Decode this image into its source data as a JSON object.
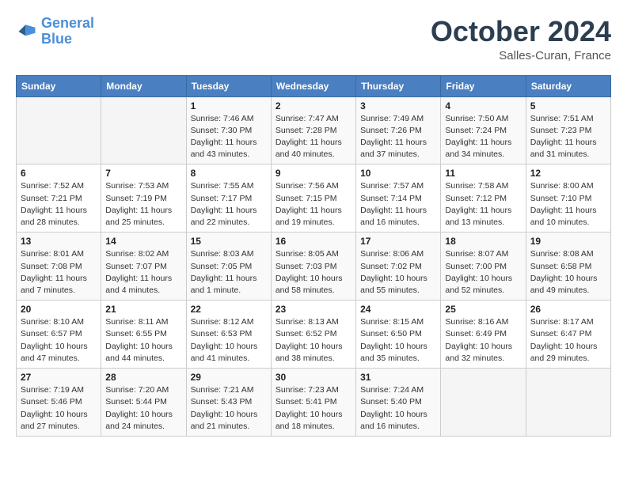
{
  "header": {
    "logo_line1": "General",
    "logo_line2": "Blue",
    "month_title": "October 2024",
    "location": "Salles-Curan, France"
  },
  "weekdays": [
    "Sunday",
    "Monday",
    "Tuesday",
    "Wednesday",
    "Thursday",
    "Friday",
    "Saturday"
  ],
  "weeks": [
    [
      null,
      null,
      {
        "day": 1,
        "sunrise": "7:46 AM",
        "sunset": "7:30 PM",
        "daylight": "11 hours and 43 minutes."
      },
      {
        "day": 2,
        "sunrise": "7:47 AM",
        "sunset": "7:28 PM",
        "daylight": "11 hours and 40 minutes."
      },
      {
        "day": 3,
        "sunrise": "7:49 AM",
        "sunset": "7:26 PM",
        "daylight": "11 hours and 37 minutes."
      },
      {
        "day": 4,
        "sunrise": "7:50 AM",
        "sunset": "7:24 PM",
        "daylight": "11 hours and 34 minutes."
      },
      {
        "day": 5,
        "sunrise": "7:51 AM",
        "sunset": "7:23 PM",
        "daylight": "11 hours and 31 minutes."
      }
    ],
    [
      {
        "day": 6,
        "sunrise": "7:52 AM",
        "sunset": "7:21 PM",
        "daylight": "11 hours and 28 minutes."
      },
      {
        "day": 7,
        "sunrise": "7:53 AM",
        "sunset": "7:19 PM",
        "daylight": "11 hours and 25 minutes."
      },
      {
        "day": 8,
        "sunrise": "7:55 AM",
        "sunset": "7:17 PM",
        "daylight": "11 hours and 22 minutes."
      },
      {
        "day": 9,
        "sunrise": "7:56 AM",
        "sunset": "7:15 PM",
        "daylight": "11 hours and 19 minutes."
      },
      {
        "day": 10,
        "sunrise": "7:57 AM",
        "sunset": "7:14 PM",
        "daylight": "11 hours and 16 minutes."
      },
      {
        "day": 11,
        "sunrise": "7:58 AM",
        "sunset": "7:12 PM",
        "daylight": "11 hours and 13 minutes."
      },
      {
        "day": 12,
        "sunrise": "8:00 AM",
        "sunset": "7:10 PM",
        "daylight": "11 hours and 10 minutes."
      }
    ],
    [
      {
        "day": 13,
        "sunrise": "8:01 AM",
        "sunset": "7:08 PM",
        "daylight": "11 hours and 7 minutes."
      },
      {
        "day": 14,
        "sunrise": "8:02 AM",
        "sunset": "7:07 PM",
        "daylight": "11 hours and 4 minutes."
      },
      {
        "day": 15,
        "sunrise": "8:03 AM",
        "sunset": "7:05 PM",
        "daylight": "11 hours and 1 minute."
      },
      {
        "day": 16,
        "sunrise": "8:05 AM",
        "sunset": "7:03 PM",
        "daylight": "10 hours and 58 minutes."
      },
      {
        "day": 17,
        "sunrise": "8:06 AM",
        "sunset": "7:02 PM",
        "daylight": "10 hours and 55 minutes."
      },
      {
        "day": 18,
        "sunrise": "8:07 AM",
        "sunset": "7:00 PM",
        "daylight": "10 hours and 52 minutes."
      },
      {
        "day": 19,
        "sunrise": "8:08 AM",
        "sunset": "6:58 PM",
        "daylight": "10 hours and 49 minutes."
      }
    ],
    [
      {
        "day": 20,
        "sunrise": "8:10 AM",
        "sunset": "6:57 PM",
        "daylight": "10 hours and 47 minutes."
      },
      {
        "day": 21,
        "sunrise": "8:11 AM",
        "sunset": "6:55 PM",
        "daylight": "10 hours and 44 minutes."
      },
      {
        "day": 22,
        "sunrise": "8:12 AM",
        "sunset": "6:53 PM",
        "daylight": "10 hours and 41 minutes."
      },
      {
        "day": 23,
        "sunrise": "8:13 AM",
        "sunset": "6:52 PM",
        "daylight": "10 hours and 38 minutes."
      },
      {
        "day": 24,
        "sunrise": "8:15 AM",
        "sunset": "6:50 PM",
        "daylight": "10 hours and 35 minutes."
      },
      {
        "day": 25,
        "sunrise": "8:16 AM",
        "sunset": "6:49 PM",
        "daylight": "10 hours and 32 minutes."
      },
      {
        "day": 26,
        "sunrise": "8:17 AM",
        "sunset": "6:47 PM",
        "daylight": "10 hours and 29 minutes."
      }
    ],
    [
      {
        "day": 27,
        "sunrise": "7:19 AM",
        "sunset": "5:46 PM",
        "daylight": "10 hours and 27 minutes."
      },
      {
        "day": 28,
        "sunrise": "7:20 AM",
        "sunset": "5:44 PM",
        "daylight": "10 hours and 24 minutes."
      },
      {
        "day": 29,
        "sunrise": "7:21 AM",
        "sunset": "5:43 PM",
        "daylight": "10 hours and 21 minutes."
      },
      {
        "day": 30,
        "sunrise": "7:23 AM",
        "sunset": "5:41 PM",
        "daylight": "10 hours and 18 minutes."
      },
      {
        "day": 31,
        "sunrise": "7:24 AM",
        "sunset": "5:40 PM",
        "daylight": "10 hours and 16 minutes."
      },
      null,
      null
    ]
  ],
  "labels": {
    "sunrise": "Sunrise:",
    "sunset": "Sunset:",
    "daylight": "Daylight:"
  }
}
